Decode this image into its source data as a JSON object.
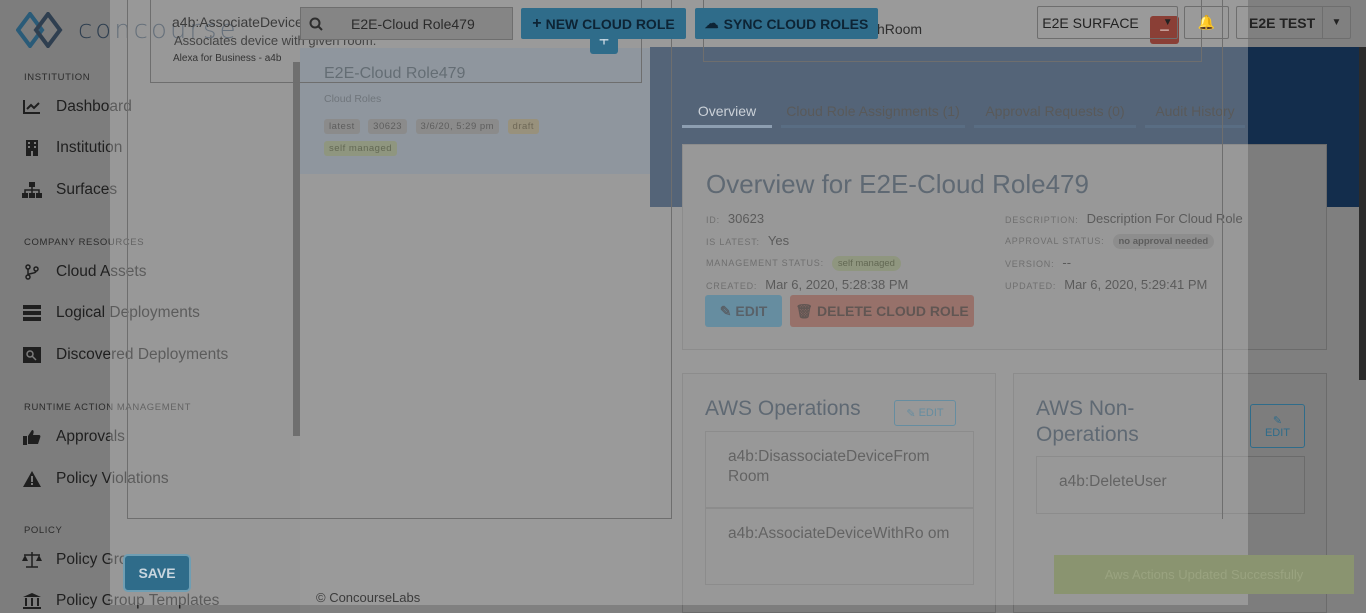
{
  "app": {
    "logo_text": "concourse"
  },
  "sidebar": {
    "sections": [
      {
        "title": "INSTITUTION",
        "items": [
          {
            "label": "Dashboard",
            "icon": "chart-line-icon"
          },
          {
            "label": "Institution",
            "icon": "building-icon"
          },
          {
            "label": "Surfaces",
            "icon": "sitemap-icon"
          }
        ]
      },
      {
        "title": "COMPANY RESOURCES",
        "items": [
          {
            "label": "Cloud Assets",
            "icon": "code-branch-icon"
          },
          {
            "label": "Logical Deployments",
            "icon": "server-icon"
          },
          {
            "label": "Discovered Deployments",
            "icon": "discovered-icon"
          }
        ]
      },
      {
        "title": "RUNTIME ACTION MANAGEMENT",
        "items": [
          {
            "label": "Approvals",
            "icon": "thumbs-up-icon"
          },
          {
            "label": "Policy Violations",
            "icon": "warning-icon"
          }
        ]
      },
      {
        "title": "POLICY",
        "items": [
          {
            "label": "Policy Groups",
            "icon": "balance-scale-icon"
          },
          {
            "label": "Policy Group Templates",
            "icon": "institution-icon"
          }
        ]
      }
    ]
  },
  "topbar": {
    "search_value": "E2E-Cloud Role479",
    "new_button": "NEW CLOUD ROLE",
    "sync_button": "SYNC CLOUD ROLES",
    "surface_label": "E2E SURFACE",
    "user_label": "E2E TEST"
  },
  "list": {
    "item": {
      "title": "E2E-Cloud Role479",
      "subtitle": "Cloud Roles",
      "tags": [
        "latest",
        "30623",
        "3/6/20, 5:29 pm",
        "draft",
        "self managed"
      ]
    }
  },
  "detail": {
    "tabs": [
      "Overview",
      "Cloud Role Assignments (1)",
      "Approval Requests (0)",
      "Audit History"
    ],
    "overview": {
      "title": "Overview for E2E-Cloud Role479",
      "id_label": "ID:",
      "id_value": "30623",
      "is_latest_label": "IS LATEST:",
      "is_latest_value": "Yes",
      "mgmt_label": "MANAGEMENT STATUS:",
      "mgmt_value": "self managed",
      "created_label": "CREATED:",
      "created_value": "Mar 6, 2020, 5:28:38 PM",
      "desc_label": "DESCRIPTION:",
      "desc_value": "Description For Cloud Role",
      "approval_label": "APPROVAL STATUS:",
      "approval_value": "no approval needed",
      "version_label": "VERSION:",
      "version_value": "--",
      "updated_label": "UPDATED:",
      "updated_value": "Mar 6, 2020, 5:29:41 PM",
      "edit_button": "EDIT",
      "delete_button": "DELETE CLOUD ROLE"
    },
    "aws_ops": {
      "title": "AWS Operations",
      "edit": "EDIT",
      "items": [
        "a4b:DisassociateDeviceFrom Room",
        "a4b:AssociateDeviceWithRo om"
      ]
    },
    "aws_non_ops": {
      "title": "AWS Non-Operations",
      "edit": "EDIT",
      "items": [
        "a4b:DeleteUser"
      ]
    }
  },
  "modal": {
    "suggest_title": "a4b:AssociateDeviceWithRoom",
    "suggest_desc": "Associates device with given room.",
    "suggest_source": "Alexa for Business - a4b",
    "selected_item": "a4b:AssociateDeviceWithRoom",
    "save_button": "SAVE"
  },
  "toast": "Aws Actions Updated Successfully",
  "footer": "© ConcourseLabs"
}
